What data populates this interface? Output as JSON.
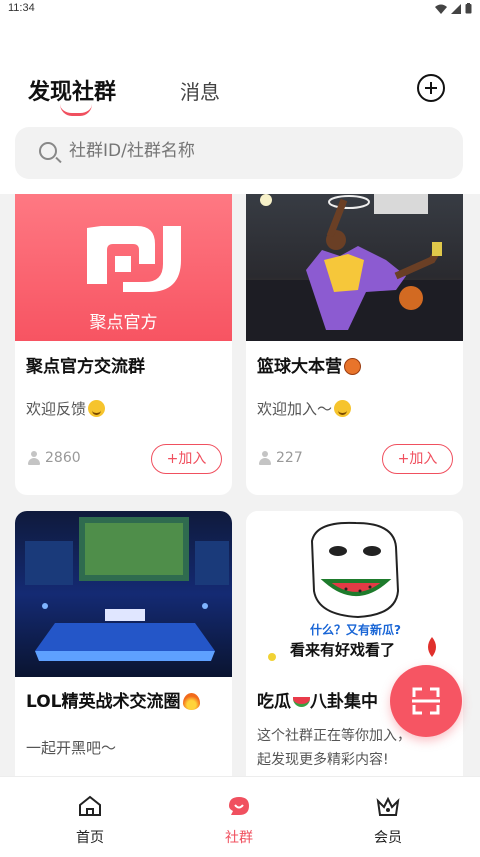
{
  "status_bar": {
    "time": "11:34"
  },
  "header": {
    "tabs": [
      {
        "label": "发现社群",
        "active": true
      },
      {
        "label": "消息",
        "active": false
      }
    ]
  },
  "search": {
    "placeholder": "社群ID/社群名称"
  },
  "groups": [
    {
      "title": "聚点官方交流群",
      "desc": "欢迎反馈",
      "desc_emoji": "smiling-face-with-halo",
      "members": "2860",
      "join_label": "+加入",
      "logo_text": "聚点官方"
    },
    {
      "title": "篮球大本营",
      "title_emoji": "basketball",
      "desc": "欢迎加入～",
      "desc_emoji": "grinning-face",
      "members": "227",
      "join_label": "+加入"
    },
    {
      "title": "LOL精英战术交流圈",
      "title_emoji": "fire",
      "desc": "一起开黑吧～"
    },
    {
      "title": "吃瓜",
      "title_emoji": "watermelon",
      "title_suffix": "八卦集中",
      "desc": "这个社群正在等你加入，",
      "desc_line2": "起发现更多精彩内容!",
      "image_text_line1": "什么？又有新瓜?",
      "image_text_line2": "看来有好戏看了"
    }
  ],
  "bottom_nav": [
    {
      "label": "首页",
      "icon": "home-icon",
      "active": false
    },
    {
      "label": "社群",
      "icon": "community-icon",
      "active": true
    },
    {
      "label": "会员",
      "icon": "crown-icon",
      "active": false
    }
  ],
  "colors": {
    "accent": "#f0505f",
    "feed_bg": "#f2f2f2"
  }
}
